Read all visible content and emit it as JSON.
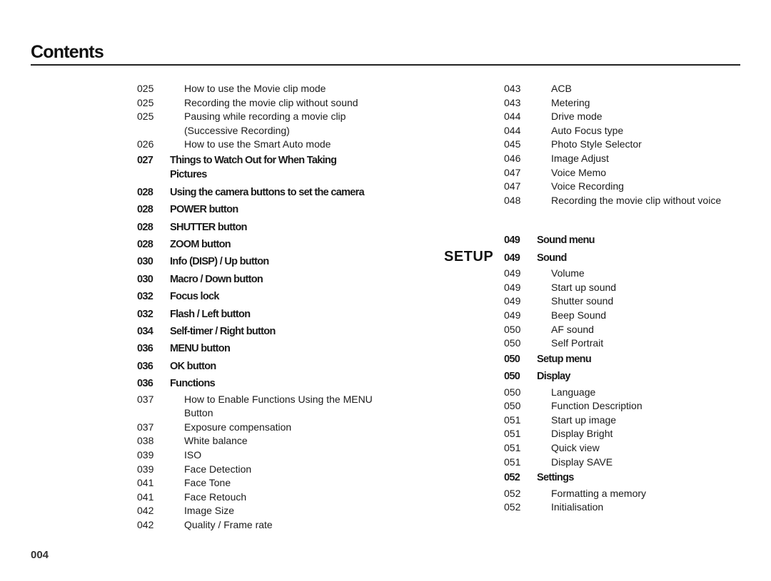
{
  "header": {
    "title": "Contents"
  },
  "left_column": [
    {
      "page": "025",
      "text": "How to use the Movie clip mode",
      "level": "sub"
    },
    {
      "page": "025",
      "text": "Recording the movie clip without sound",
      "level": "sub"
    },
    {
      "page": "025",
      "text": "Pausing while recording a movie clip",
      "level": "sub"
    },
    {
      "page": "",
      "text": "(Successive Recording)",
      "level": "sub"
    },
    {
      "page": "026",
      "text": "How to use the Smart Auto mode",
      "level": "sub"
    },
    {
      "page": "027",
      "text": "Things to Watch Out for When Taking",
      "level": "main"
    },
    {
      "page": "",
      "text": "Pictures",
      "level": "main-cont"
    },
    {
      "page": "028",
      "text": "Using the camera buttons to set the camera",
      "level": "main"
    },
    {
      "page": "028",
      "text": "POWER button",
      "level": "main"
    },
    {
      "page": "028",
      "text": "SHUTTER button",
      "level": "main"
    },
    {
      "page": "028",
      "text": "ZOOM button",
      "level": "main"
    },
    {
      "page": "030",
      "text": "Info (DISP) / Up button",
      "level": "main"
    },
    {
      "page": "030",
      "text": "Macro / Down button",
      "level": "main"
    },
    {
      "page": "032",
      "text": "Focus lock",
      "level": "main"
    },
    {
      "page": "032",
      "text": "Flash / Left button",
      "level": "main"
    },
    {
      "page": "034",
      "text": "Self-timer / Right button",
      "level": "main"
    },
    {
      "page": "036",
      "text": "MENU button",
      "level": "main"
    },
    {
      "page": "036",
      "text": "OK button",
      "level": "main"
    },
    {
      "page": "036",
      "text": "Functions",
      "level": "main"
    },
    {
      "page": "037",
      "text": "How to Enable Functions Using the MENU",
      "level": "sub"
    },
    {
      "page": "",
      "text": "Button",
      "level": "sub"
    },
    {
      "page": "037",
      "text": "Exposure compensation",
      "level": "sub"
    },
    {
      "page": "038",
      "text": "White balance",
      "level": "sub"
    },
    {
      "page": "039",
      "text": "ISO",
      "level": "sub"
    },
    {
      "page": "039",
      "text": "Face Detection",
      "level": "sub"
    },
    {
      "page": "041",
      "text": "Face Tone",
      "level": "sub"
    },
    {
      "page": "041",
      "text": "Face Retouch",
      "level": "sub"
    },
    {
      "page": "042",
      "text": "Image Size",
      "level": "sub"
    },
    {
      "page": "042",
      "text": "Quality / Frame rate",
      "level": "sub"
    }
  ],
  "right_column_top": [
    {
      "page": "043",
      "text": "ACB",
      "level": "sub"
    },
    {
      "page": "043",
      "text": "Metering",
      "level": "sub"
    },
    {
      "page": "044",
      "text": "Drive mode",
      "level": "sub"
    },
    {
      "page": "044",
      "text": "Auto Focus type",
      "level": "sub"
    },
    {
      "page": "045",
      "text": "Photo Style Selector",
      "level": "sub"
    },
    {
      "page": "046",
      "text": "Image Adjust",
      "level": "sub"
    },
    {
      "page": "047",
      "text": "Voice Memo",
      "level": "sub"
    },
    {
      "page": "047",
      "text": "Voice Recording",
      "level": "sub"
    },
    {
      "page": "048",
      "text": "Recording the movie clip without voice",
      "level": "sub"
    }
  ],
  "setup_section": {
    "label": "SETUP",
    "entries": [
      {
        "page": "049",
        "text": "Sound menu",
        "level": "main"
      },
      {
        "page": "049",
        "text": "Sound",
        "level": "main"
      },
      {
        "page": "049",
        "text": "Volume",
        "level": "sub"
      },
      {
        "page": "049",
        "text": "Start up sound",
        "level": "sub"
      },
      {
        "page": "049",
        "text": "Shutter sound",
        "level": "sub"
      },
      {
        "page": "049",
        "text": "Beep Sound",
        "level": "sub"
      },
      {
        "page": "050",
        "text": "AF sound",
        "level": "sub"
      },
      {
        "page": "050",
        "text": "Self Portrait",
        "level": "sub"
      },
      {
        "page": "050",
        "text": "Setup menu",
        "level": "main"
      },
      {
        "page": "050",
        "text": "Display",
        "level": "main"
      },
      {
        "page": "050",
        "text": "Language",
        "level": "sub"
      },
      {
        "page": "050",
        "text": "Function Description",
        "level": "sub"
      },
      {
        "page": "051",
        "text": "Start up image",
        "level": "sub"
      },
      {
        "page": "051",
        "text": "Display Bright",
        "level": "sub"
      },
      {
        "page": "051",
        "text": "Quick view",
        "level": "sub"
      },
      {
        "page": "051",
        "text": "Display SAVE",
        "level": "sub"
      },
      {
        "page": "052",
        "text": "Settings",
        "level": "main"
      },
      {
        "page": "052",
        "text": "Formatting a memory",
        "level": "sub"
      },
      {
        "page": "052",
        "text": "Initialisation",
        "level": "sub"
      }
    ]
  },
  "footer": {
    "page_number": "004"
  }
}
